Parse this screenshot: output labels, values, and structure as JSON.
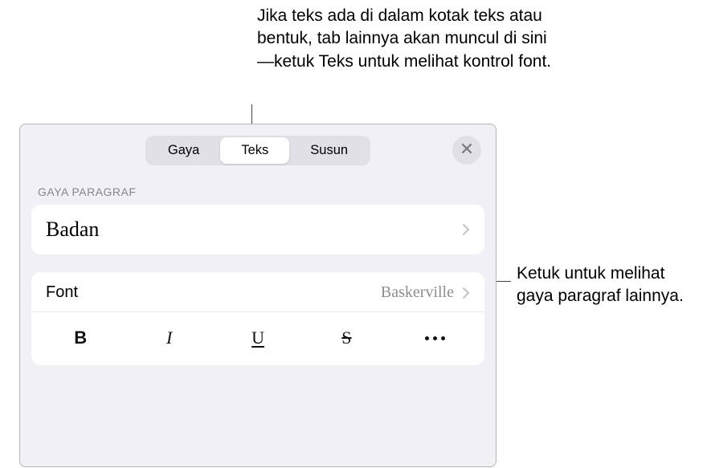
{
  "callouts": {
    "top": "Jika teks ada di dalam kotak teks atau bentuk, tab lainnya akan muncul di sini—ketuk Teks untuk melihat kontrol font.",
    "right": "Ketuk untuk melihat gaya paragraf lainnya."
  },
  "tabs": {
    "style": "Gaya",
    "text": "Teks",
    "arrange": "Susun"
  },
  "section": {
    "paragraph_style_label": "GAYA PARAGRAF",
    "paragraph_style_value": "Badan"
  },
  "font": {
    "label": "Font",
    "value": "Baskerville"
  },
  "style_buttons": {
    "bold": "B",
    "italic": "I",
    "underline": "U",
    "strike": "S"
  }
}
